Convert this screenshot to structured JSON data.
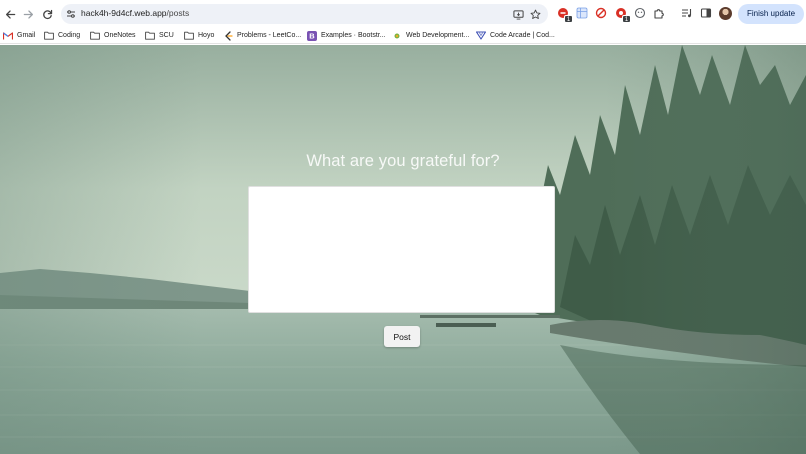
{
  "browser": {
    "url_host": "hack4h-9d4cf.web.app",
    "url_path": "/posts",
    "update_button_label": "Finish update",
    "extension_badges": [
      "1",
      "1"
    ]
  },
  "bookmarks": [
    {
      "label": "Gmail",
      "icon": "gmail-icon"
    },
    {
      "label": "Coding",
      "icon": "folder-icon"
    },
    {
      "label": "OneNotes",
      "icon": "folder-icon"
    },
    {
      "label": "SCU",
      "icon": "folder-icon"
    },
    {
      "label": "Hoyo",
      "icon": "folder-icon"
    },
    {
      "label": "Problems - LeetCo...",
      "icon": "leetcode-icon"
    },
    {
      "label": "Examples · Bootstr...",
      "icon": "bootstrap-icon"
    },
    {
      "label": "Web Development...",
      "icon": "web-dev-icon"
    },
    {
      "label": "Code Arcade | Cod...",
      "icon": "code-arcade-icon"
    }
  ],
  "page": {
    "heading": "What are you grateful for?",
    "textarea_value": "",
    "post_button_label": "Post"
  },
  "colors": {
    "update_button_bg": "#d3e3fd",
    "bootstrap_purple": "#7952b3",
    "lake_tint": "#8aa698"
  }
}
